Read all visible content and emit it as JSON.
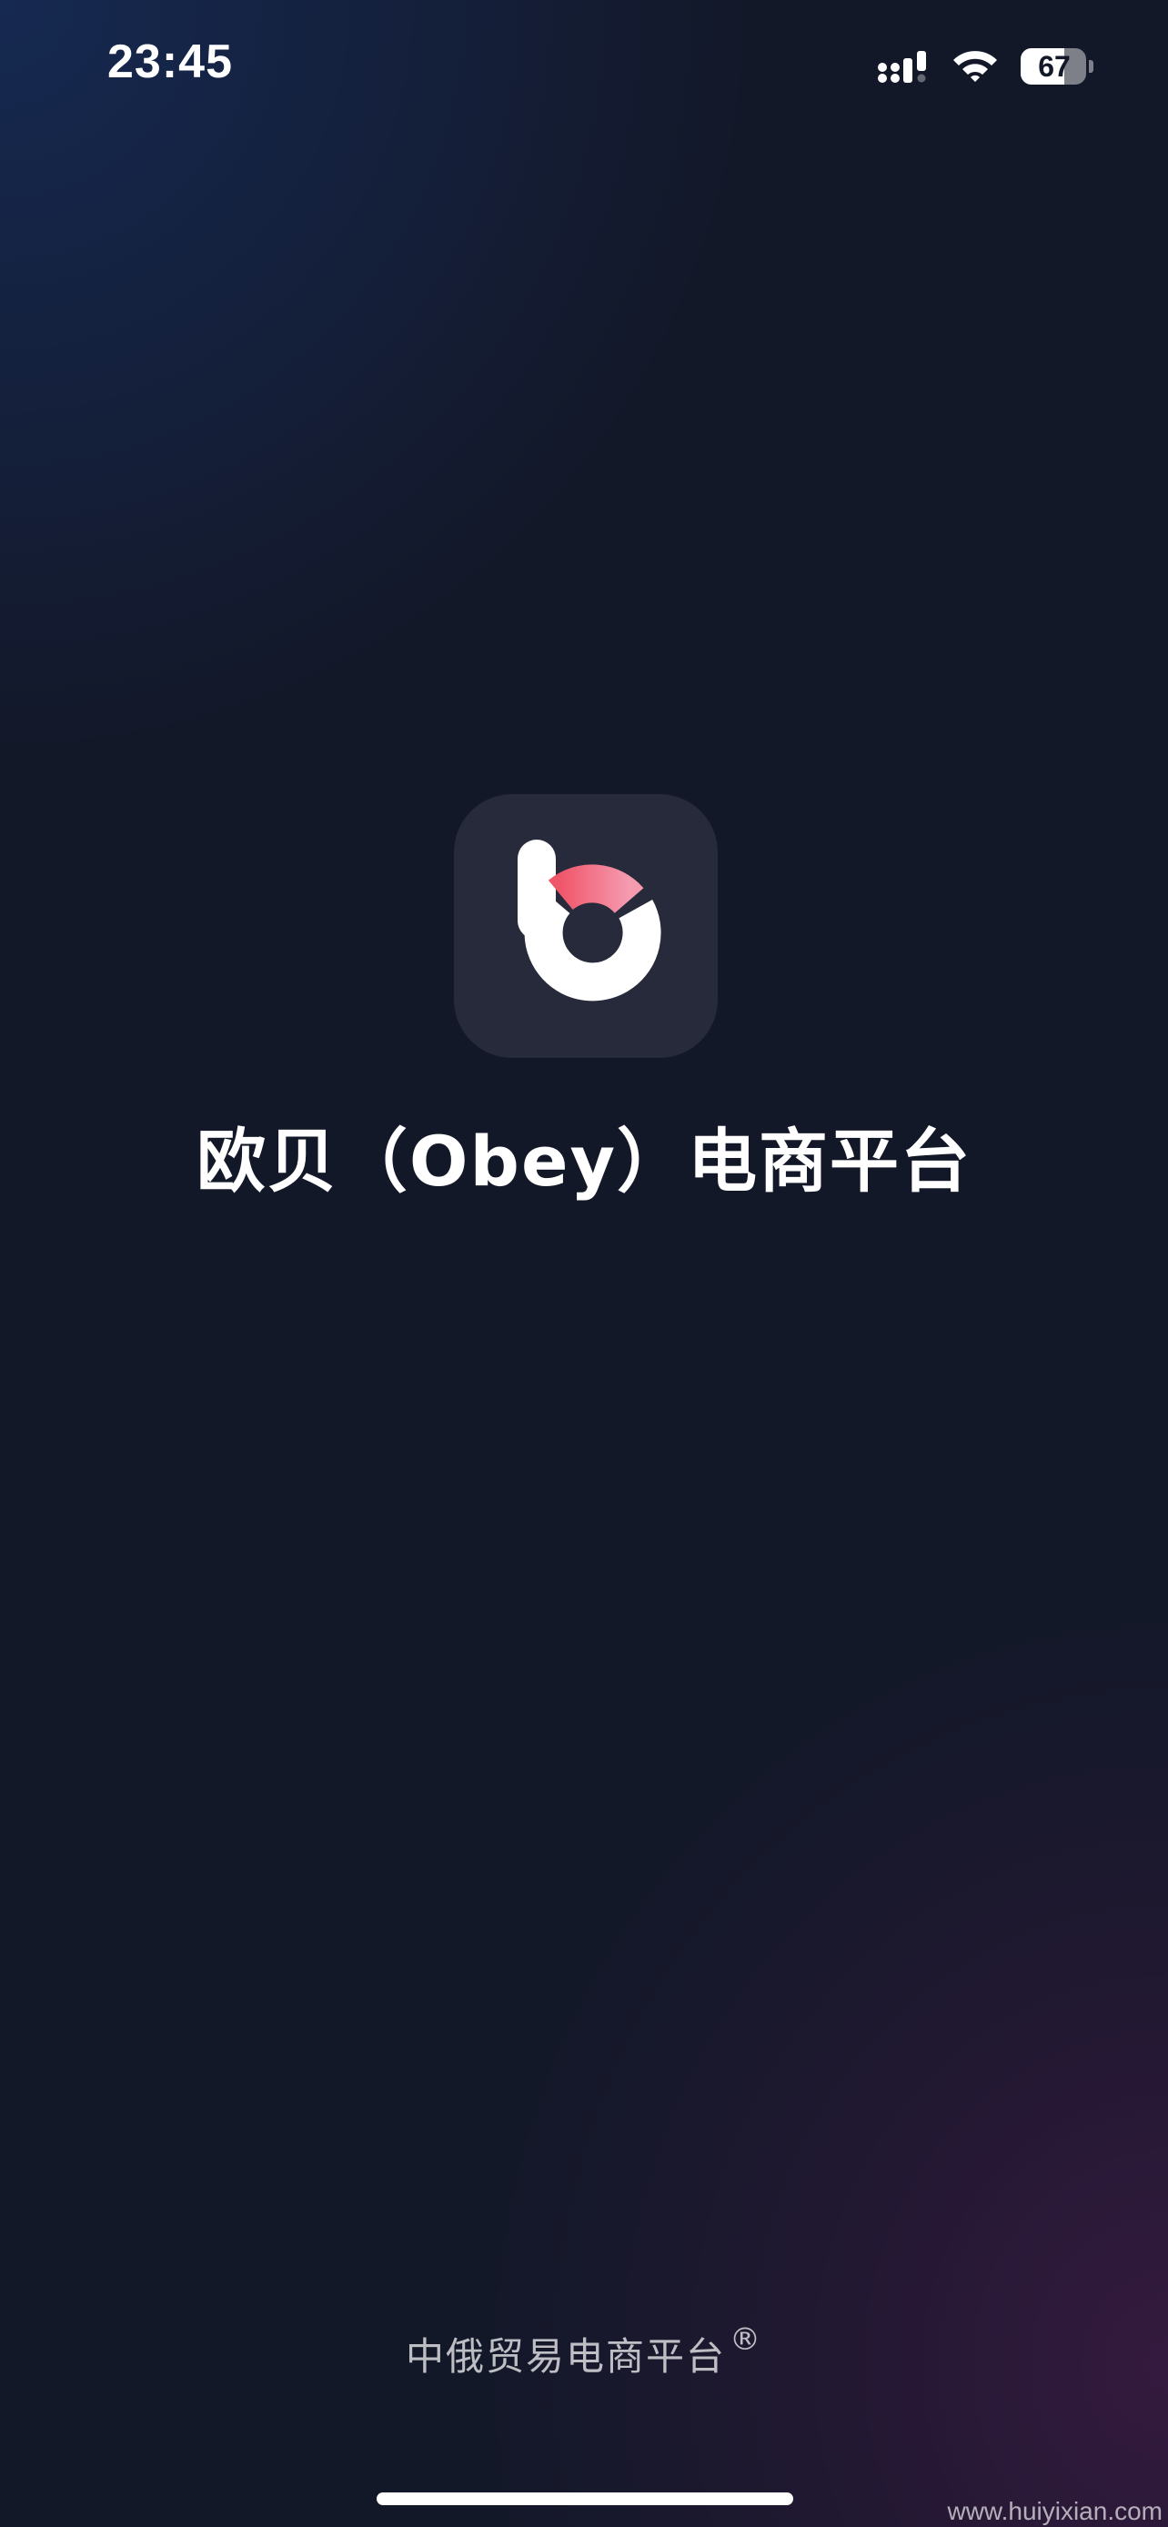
{
  "status_bar": {
    "time": "23:45",
    "battery_percent": 67,
    "battery_text": "67",
    "signal_icon": "cellular-signal-icon",
    "wifi_icon": "wifi-icon"
  },
  "app": {
    "logo_icon": "obey-b-logo-icon",
    "title": "欧贝（Obey）电商平台",
    "accent_color": "#f0566a",
    "accent_color_light": "#f59bb0"
  },
  "footer": {
    "slogan": "中俄贸易电商平台",
    "registered_mark": "®",
    "watermark": "www.huiyixian.com"
  }
}
